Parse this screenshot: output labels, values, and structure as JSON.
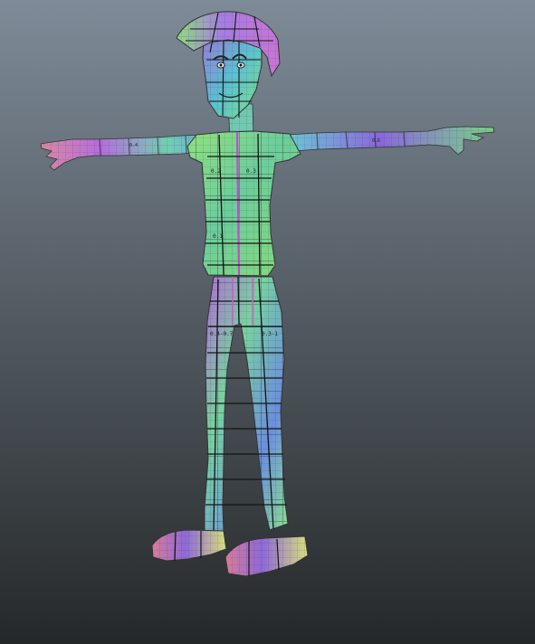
{
  "viewport": {
    "background_top": "#7e8b98",
    "background_bottom": "#252829"
  },
  "model": {
    "colors": {
      "green": "#7fd989",
      "teal": "#58c7b0",
      "purple": "#8e67d7",
      "magenta": "#c05fd3",
      "pink": "#d8809d",
      "yellow": "#d7e06e",
      "line": "#141414"
    },
    "uv_labels": {
      "chest": [
        "0.2",
        "0.3",
        "0.1"
      ],
      "legs": [
        "0.4-0.7",
        "0.3-1"
      ]
    }
  }
}
